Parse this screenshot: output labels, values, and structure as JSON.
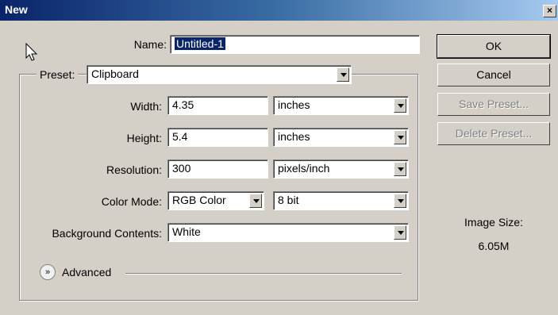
{
  "window": {
    "title": "New",
    "close_label": "×"
  },
  "name": {
    "label": "Name:",
    "value": "Untitled-1"
  },
  "preset": {
    "label": "Preset:",
    "value": "Clipboard"
  },
  "width": {
    "label": "Width:",
    "value": "4.35",
    "unit": "inches"
  },
  "height": {
    "label": "Height:",
    "value": "5.4",
    "unit": "inches"
  },
  "resolution": {
    "label": "Resolution:",
    "value": "300",
    "unit": "pixels/inch"
  },
  "color_mode": {
    "label": "Color Mode:",
    "value": "RGB Color",
    "depth": "8 bit"
  },
  "background": {
    "label": "Background Contents:",
    "value": "White"
  },
  "advanced": {
    "label": "Advanced"
  },
  "buttons": {
    "ok": "OK",
    "cancel": "Cancel",
    "save_preset": "Save Preset...",
    "delete_preset": "Delete Preset..."
  },
  "image_size": {
    "label": "Image Size:",
    "value": "6.05M"
  }
}
